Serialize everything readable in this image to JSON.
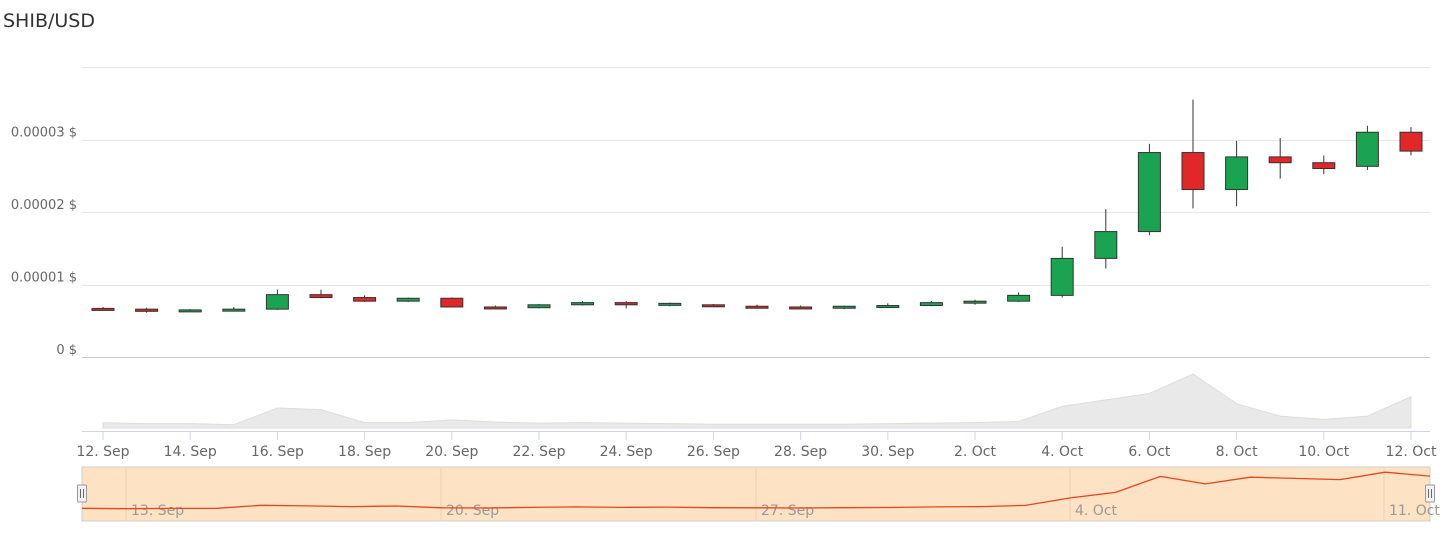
{
  "chart_data": {
    "type": "candlestick",
    "title": "SHIB/USD",
    "xlabel": "",
    "ylabel": "",
    "y_unit": "$",
    "ylim": [
      0,
      4e-05
    ],
    "yticks": [
      "0 $",
      "0.00001 $",
      "0.00002 $",
      "0.00003 $"
    ],
    "x_tick_labels": [
      "12. Sep",
      "14. Sep",
      "16. Sep",
      "18. Sep",
      "20. Sep",
      "22. Sep",
      "24. Sep",
      "26. Sep",
      "28. Sep",
      "30. Sep",
      "2. Oct",
      "4. Oct",
      "6. Oct",
      "8. Oct",
      "10. Oct",
      "12. Oct"
    ],
    "navigator_labels": [
      "13. Sep",
      "20. Sep",
      "27. Sep",
      "4. Oct",
      "11. Oct"
    ],
    "candles": [
      {
        "date": "12. Sep",
        "open": 6.7e-06,
        "high": 6.9e-06,
        "low": 6.5e-06,
        "close": 6.6e-06
      },
      {
        "date": "13. Sep",
        "open": 6.6e-06,
        "high": 6.8e-06,
        "low": 6.1e-06,
        "close": 6.3e-06
      },
      {
        "date": "14. Sep",
        "open": 6.3e-06,
        "high": 6.6e-06,
        "low": 6.2e-06,
        "close": 6.5e-06
      },
      {
        "date": "15. Sep",
        "open": 6.5e-06,
        "high": 6.9e-06,
        "low": 6.4e-06,
        "close": 6.6e-06
      },
      {
        "date": "16. Sep",
        "open": 6.6e-06,
        "high": 9.3e-06,
        "low": 6.5e-06,
        "close": 8.6e-06
      },
      {
        "date": "17. Sep",
        "open": 8.6e-06,
        "high": 9.3e-06,
        "low": 8.1e-06,
        "close": 8.2e-06
      },
      {
        "date": "18. Sep",
        "open": 8.2e-06,
        "high": 8.5e-06,
        "low": 7.6e-06,
        "close": 7.7e-06
      },
      {
        "date": "19. Sep",
        "open": 7.7e-06,
        "high": 8.2e-06,
        "low": 7.6e-06,
        "close": 8.1e-06
      },
      {
        "date": "20. Sep",
        "open": 8.1e-06,
        "high": 8.2e-06,
        "low": 6.9e-06,
        "close": 6.9e-06
      },
      {
        "date": "21. Sep",
        "open": 6.9e-06,
        "high": 7.1e-06,
        "low": 6.6e-06,
        "close": 6.8e-06
      },
      {
        "date": "22. Sep",
        "open": 6.8e-06,
        "high": 7.3e-06,
        "low": 6.7e-06,
        "close": 7.2e-06
      },
      {
        "date": "23. Sep",
        "open": 7.2e-06,
        "high": 7.7e-06,
        "low": 7.1e-06,
        "close": 7.5e-06
      },
      {
        "date": "24. Sep",
        "open": 7.5e-06,
        "high": 7.7e-06,
        "low": 6.7e-06,
        "close": 7.2e-06
      },
      {
        "date": "25. Sep",
        "open": 7.2e-06,
        "high": 7.5e-06,
        "low": 7e-06,
        "close": 7.4e-06
      },
      {
        "date": "26. Sep",
        "open": 7.2e-06,
        "high": 7.3e-06,
        "low": 6.9e-06,
        "close": 7e-06
      },
      {
        "date": "27. Sep",
        "open": 7e-06,
        "high": 7.2e-06,
        "low": 6.8e-06,
        "close": 6.9e-06
      },
      {
        "date": "28. Sep",
        "open": 6.9e-06,
        "high": 7.1e-06,
        "low": 6.6e-06,
        "close": 6.8e-06
      },
      {
        "date": "29. Sep",
        "open": 6.8e-06,
        "high": 7.1e-06,
        "low": 6.6e-06,
        "close": 7e-06
      },
      {
        "date": "30. Sep",
        "open": 7e-06,
        "high": 7.4e-06,
        "low": 6.8e-06,
        "close": 7.1e-06
      },
      {
        "date": "1. Oct",
        "open": 7.1e-06,
        "high": 7.7e-06,
        "low": 7e-06,
        "close": 7.5e-06
      },
      {
        "date": "2. Oct",
        "open": 7.5e-06,
        "high": 7.9e-06,
        "low": 7.2e-06,
        "close": 7.7e-06
      },
      {
        "date": "3. Oct",
        "open": 7.7e-06,
        "high": 8.9e-06,
        "low": 7.6e-06,
        "close": 8.5e-06
      },
      {
        "date": "4. Oct",
        "open": 8.5e-06,
        "high": 1.52e-05,
        "low": 8.2e-06,
        "close": 1.36e-05
      },
      {
        "date": "5. Oct",
        "open": 1.36e-05,
        "high": 2.04e-05,
        "low": 1.22e-05,
        "close": 1.73e-05
      },
      {
        "date": "6. Oct",
        "open": 1.73e-05,
        "high": 2.94e-05,
        "low": 1.68e-05,
        "close": 2.82e-05
      },
      {
        "date": "7. Oct",
        "open": 2.82e-05,
        "high": 3.55e-05,
        "low": 2.05e-05,
        "close": 2.31e-05
      },
      {
        "date": "8. Oct",
        "open": 2.31e-05,
        "high": 2.98e-05,
        "low": 2.08e-05,
        "close": 2.76e-05
      },
      {
        "date": "9. Oct",
        "open": 2.76e-05,
        "high": 3.02e-05,
        "low": 2.46e-05,
        "close": 2.68e-05
      },
      {
        "date": "10. Oct",
        "open": 2.68e-05,
        "high": 2.78e-05,
        "low": 2.52e-05,
        "close": 2.6e-05
      },
      {
        "date": "11. Oct",
        "open": 2.63e-05,
        "high": 3.19e-05,
        "low": 2.58e-05,
        "close": 3.1e-05
      },
      {
        "date": "12. Oct",
        "open": 3.1e-05,
        "high": 3.17e-05,
        "low": 2.78e-05,
        "close": 2.84e-05
      }
    ],
    "volume_relative": [
      0.1,
      0.08,
      0.08,
      0.06,
      0.37,
      0.34,
      0.1,
      0.1,
      0.15,
      0.11,
      0.09,
      0.1,
      0.09,
      0.08,
      0.07,
      0.07,
      0.07,
      0.07,
      0.08,
      0.09,
      0.1,
      0.12,
      0.4,
      0.52,
      0.64,
      1.0,
      0.45,
      0.22,
      0.16,
      0.22,
      0.58
    ],
    "colors": {
      "up": "#1aa451",
      "down": "#e12727",
      "wick": "#333333",
      "volume": "#e9e9e9",
      "navigator_fill": "#fde2c3",
      "navigator_line": "#e8441f"
    },
    "grid": true
  }
}
